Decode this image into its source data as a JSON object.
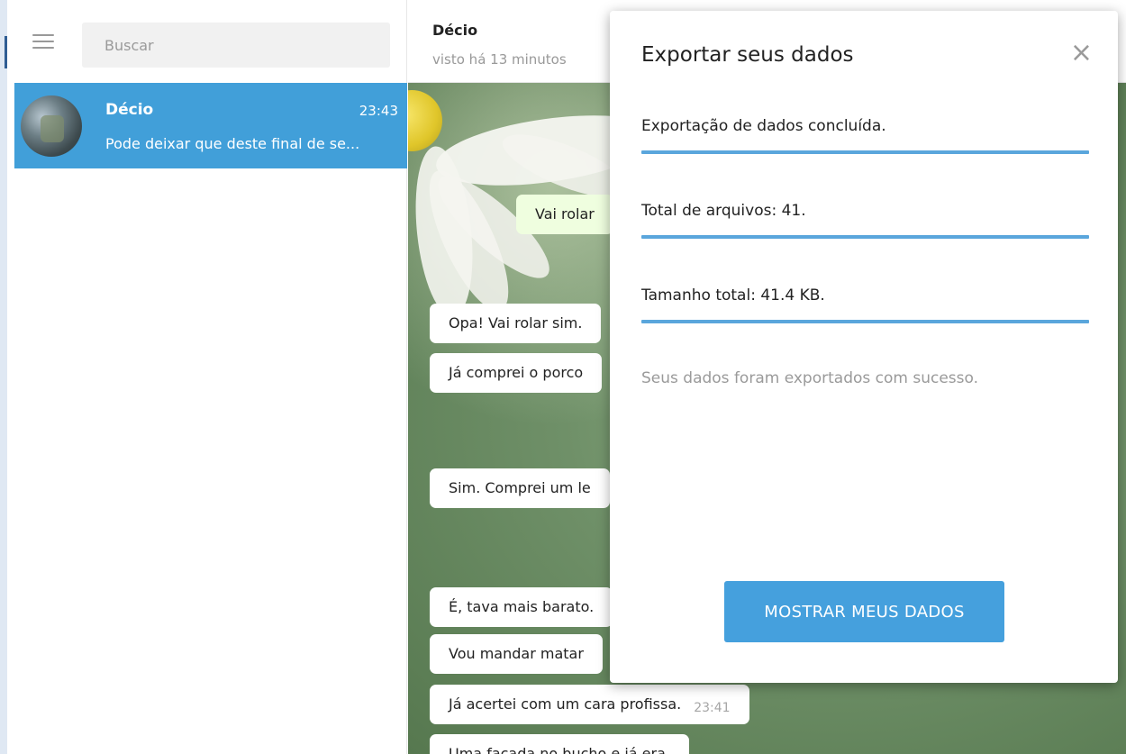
{
  "sidebar": {
    "search": {
      "placeholder": "Buscar"
    },
    "dialogs": [
      {
        "name": "Décio",
        "time": "23:43",
        "preview": "Pode deixar que deste final de se..."
      }
    ]
  },
  "chat": {
    "peer_name": "Décio",
    "peer_status": "visto há 13 minutos",
    "messages": [
      {
        "text": "Vai rolar",
        "outgoing": true,
        "time": ""
      },
      {
        "text": "Opa! Vai rolar sim.",
        "outgoing": false,
        "time": ""
      },
      {
        "text": "Já comprei o porco",
        "outgoing": false,
        "time": ""
      },
      {
        "text": "Sim. Comprei um le",
        "outgoing": false,
        "time": ""
      },
      {
        "text": "É, tava mais barato.",
        "outgoing": false,
        "time": ""
      },
      {
        "text": "Vou mandar matar",
        "outgoing": false,
        "time": ""
      },
      {
        "text": "Já acertei com um cara profissa.",
        "outgoing": false,
        "time": "23:41"
      },
      {
        "text": "Uma facada no bucho e já era.",
        "outgoing": false,
        "time": ""
      }
    ]
  },
  "export_modal": {
    "title": "Exportar seus dados",
    "close_glyph": "×",
    "stats": [
      {
        "label": "Exportação de dados concluída.",
        "progress": 1.0
      },
      {
        "label": "Total de arquivos: 41.",
        "progress": 1.0
      },
      {
        "label": "Tamanho total: 41.4 KB.",
        "progress": 1.0
      }
    ],
    "note": "Seus dados foram exportados com sucesso.",
    "button_label": "MOSTRAR MEUS DADOS"
  },
  "colors": {
    "accent": "#419fd9",
    "button": "#45a0dd",
    "progress": "#5aa6dc",
    "outgoing_bubble": "#effedf"
  },
  "icons": {
    "menu": "hamburger-icon",
    "close": "close-icon"
  }
}
